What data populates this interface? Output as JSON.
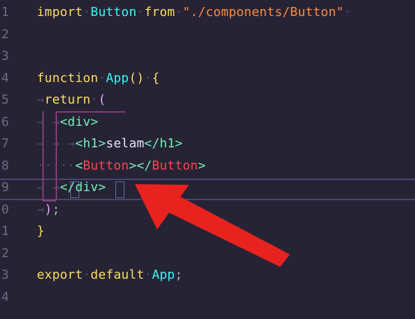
{
  "editor": {
    "lines": [
      {
        "num": "1",
        "tokens": [
          [
            "kw",
            "import"
          ],
          [
            "ws",
            "·"
          ],
          [
            "fn",
            "Button"
          ],
          [
            "ws",
            "·"
          ],
          [
            "kw",
            "from"
          ],
          [
            "ws",
            "·"
          ],
          [
            "str",
            "\"./components/Button\""
          ],
          [
            "ws",
            "·"
          ]
        ]
      },
      {
        "num": "2",
        "tokens": []
      },
      {
        "num": "3",
        "tokens": []
      },
      {
        "num": "4",
        "tokens": [
          [
            "kw",
            "function"
          ],
          [
            "ws",
            "·"
          ],
          [
            "fn",
            "App"
          ],
          [
            "brace",
            "()"
          ],
          [
            "ws",
            "·"
          ],
          [
            "brace",
            "{"
          ]
        ]
      },
      {
        "num": "5",
        "tokens": [
          [
            "ws",
            "→"
          ],
          [
            "kw",
            "return"
          ],
          [
            "ws",
            "·"
          ],
          [
            "paren",
            "("
          ]
        ]
      },
      {
        "num": "6",
        "tokens": [
          [
            "ws",
            "→ →"
          ],
          [
            "tag",
            "<div>"
          ]
        ]
      },
      {
        "num": "7",
        "tokens": [
          [
            "ws",
            "→ → →"
          ],
          [
            "tag",
            "<h1>"
          ],
          [
            "txt",
            "selam"
          ],
          [
            "tag",
            "</h1>"
          ]
        ]
      },
      {
        "num": "8",
        "tokens": [
          [
            "ws",
            "·····"
          ],
          [
            "tag",
            "<"
          ],
          [
            "comp",
            "Button"
          ],
          [
            "tag",
            "></"
          ],
          [
            "comp",
            "Button"
          ],
          [
            "tag",
            ">"
          ]
        ]
      },
      {
        "num": "9",
        "tokens": [
          [
            "ws",
            "→ →"
          ],
          [
            "tag",
            "</div>"
          ]
        ]
      },
      {
        "num": "0",
        "tokens": [
          [
            "ws",
            "→"
          ],
          [
            "paren",
            ")"
          ],
          [
            "punct",
            ";"
          ]
        ]
      },
      {
        "num": "1",
        "tokens": [
          [
            "brace",
            "}"
          ]
        ]
      },
      {
        "num": "2",
        "tokens": []
      },
      {
        "num": "3",
        "tokens": [
          [
            "kw",
            "export"
          ],
          [
            "ws",
            "·"
          ],
          [
            "kw",
            "default"
          ],
          [
            "ws",
            "·"
          ],
          [
            "fn",
            "App"
          ],
          [
            "punct",
            ";"
          ]
        ]
      },
      {
        "num": "4",
        "tokens": []
      }
    ]
  },
  "colors": {
    "background": "#262335",
    "arrow": "#e8231f",
    "guide": "#8a3a7a"
  }
}
